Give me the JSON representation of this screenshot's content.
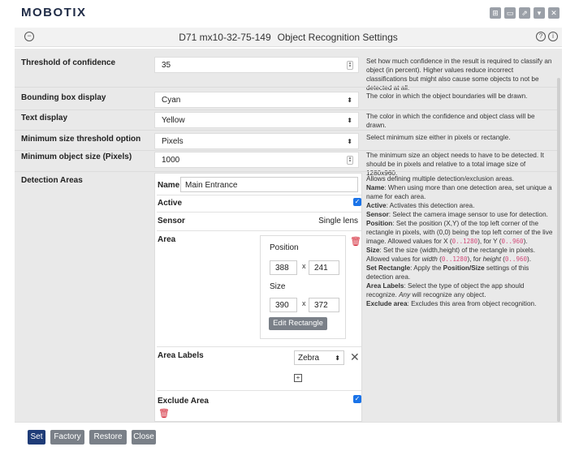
{
  "app": {
    "brand": "MOBOTIX"
  },
  "window_buttons": [
    "tile-icon",
    "minimize-icon",
    "popout-icon",
    "collapse-icon",
    "close-icon"
  ],
  "titlebar": {
    "camera": "D71 mx10-32-75-149",
    "title": "Object Recognition Settings"
  },
  "settings": [
    {
      "label": "Threshold of confidence",
      "value": "35",
      "control": "number",
      "desc": "Set how much confidence in the result is required to classify an object (in percent). Higher values reduce incorrect classifications but might also cause some objects to not be detected at all."
    },
    {
      "label": "Bounding box display",
      "value": "Cyan",
      "control": "select",
      "desc": "The color in which the object boundaries will be drawn."
    },
    {
      "label": "Text display",
      "value": "Yellow",
      "control": "select",
      "desc": "The color in which the confidence and object class will be drawn."
    },
    {
      "label": "Minimum size threshold option",
      "value": "Pixels",
      "control": "select",
      "desc": "Select minimum size either in pixels or rectangle."
    },
    {
      "label": "Minimum object size (Pixels)",
      "value": "1000",
      "control": "number",
      "desc": "The minimum size an object needs to have to be detected. It should be in pixels and relative to a total image size of 1280x960."
    }
  ],
  "detection": {
    "label": "Detection Areas",
    "name_label": "Name",
    "name_value": "Main Entrance",
    "active_label": "Active",
    "sensor_label": "Sensor",
    "sensor_value": "Single lens",
    "area_label": "Area",
    "position_label": "Position",
    "pos_x": "388",
    "pos_y": "241",
    "size_label": "Size",
    "size_w": "390",
    "size_h": "372",
    "times": "x",
    "edit_button": "Edit Rectangle",
    "area_labels_label": "Area Labels",
    "area_label_value": "Zebra",
    "exclude_label": "Exclude Area"
  },
  "detection_help": {
    "intro": "Allows defining multiple detection/exclusion areas.",
    "name_key": "Name",
    "name_text": ": When using more than one detection area, set unique a name for each area.",
    "active_key": "Active",
    "active_text": ": Activates this detection area.",
    "sensor_key": "Sensor",
    "sensor_text": ": Select the camera image sensor to use for detection.",
    "position_key": "Position",
    "position_text": ": Set the position (X,Y) of the top left corner of the rectangle in pixels, with (0,0) being the top left corner of the live image. Allowed values for X (",
    "position_x_range": "0..1280",
    "position_mid": "), for Y (",
    "position_y_range": "0..960",
    "position_end": ").",
    "size_key": "Size",
    "size_text": ": Set the size (width,height) of the rectangle in pixels. Allowed values for ",
    "size_width_word": "width",
    "size_open1": " (",
    "size_w_range": "0..1280",
    "size_mid": "), for ",
    "size_height_word": "height",
    "size_open2": " (",
    "size_h_range": "0..960",
    "size_end": ").",
    "setrect_key": "Set Rectangle",
    "setrect_text1": ": Apply the ",
    "setrect_bold": "Position/Size",
    "setrect_text2": " settings of this detection area.",
    "labels_key": "Area Labels",
    "labels_text": ": Select the type of object the app should recognize. ",
    "labels_any": "Any",
    "labels_text2": " will recognize any object.",
    "exclude_key": "Exclude area",
    "exclude_text": ": Excludes this area from object recognition."
  },
  "footer": {
    "set": "Set",
    "factory": "Factory",
    "restore": "Restore",
    "close": "Close"
  },
  "colors": {
    "primary_button": "#1f3c78",
    "secondary_button": "#7a8088",
    "checkbox": "#1a73e8",
    "delete": "#d21f2f"
  }
}
